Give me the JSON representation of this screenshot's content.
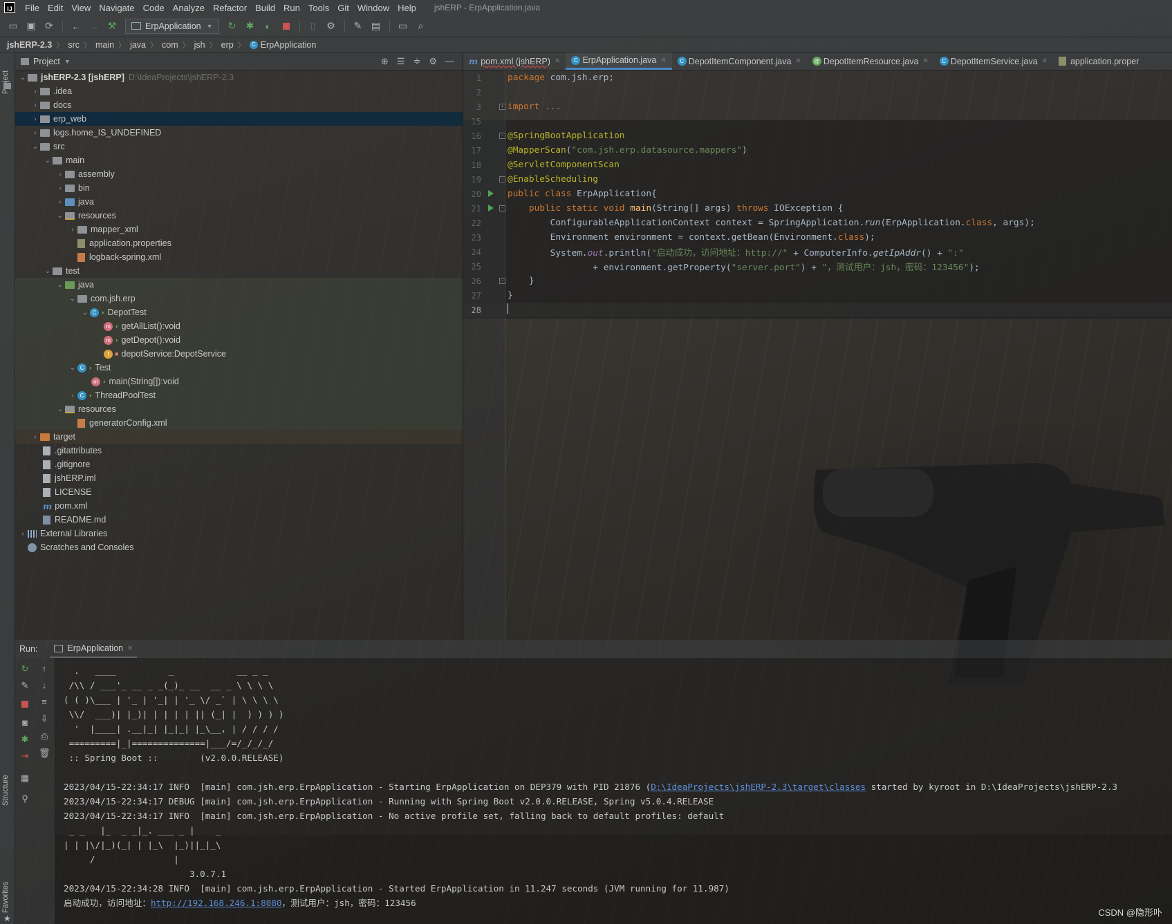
{
  "menubar": {
    "logo": "IJ",
    "items": [
      "File",
      "Edit",
      "View",
      "Navigate",
      "Code",
      "Analyze",
      "Refactor",
      "Build",
      "Run",
      "Tools",
      "Git",
      "Window",
      "Help"
    ],
    "window_title": "jshERP - ErpApplication.java"
  },
  "toolbar": {
    "run_config": "ErpApplication"
  },
  "breadcrumb": [
    "jshERP-2.3",
    "src",
    "main",
    "java",
    "com",
    "jsh",
    "erp",
    "ErpApplication"
  ],
  "side_labels": {
    "project": "Project",
    "structure": "Structure",
    "favorites": "Favorites"
  },
  "project": {
    "header": "Project",
    "tree": [
      {
        "label": "jshERP-2.3 [jshERP]",
        "hint": "D:\\IdeaProjects\\jshERP-2.3"
      },
      {
        "label": ".idea"
      },
      {
        "label": "docs"
      },
      {
        "label": "erp_web"
      },
      {
        "label": "logs.home_IS_UNDEFINED"
      },
      {
        "label": "src"
      },
      {
        "label": "main"
      },
      {
        "label": "assembly"
      },
      {
        "label": "bin"
      },
      {
        "label": "java"
      },
      {
        "label": "resources"
      },
      {
        "label": "mapper_xml"
      },
      {
        "label": "application.properties"
      },
      {
        "label": "logback-spring.xml"
      },
      {
        "label": "test"
      },
      {
        "label": "java"
      },
      {
        "label": "com.jsh.erp"
      },
      {
        "label": "DepotTest"
      },
      {
        "label": "getAllList():void"
      },
      {
        "label": "getDepot():void"
      },
      {
        "label": "depotService:DepotService"
      },
      {
        "label": "Test"
      },
      {
        "label": "main(String[]):void"
      },
      {
        "label": "ThreadPoolTest"
      },
      {
        "label": "resources"
      },
      {
        "label": "generatorConfig.xml"
      },
      {
        "label": "target"
      },
      {
        "label": ".gitattributes"
      },
      {
        "label": ".gitignore"
      },
      {
        "label": "jshERP.iml"
      },
      {
        "label": "LICENSE"
      },
      {
        "label": "pom.xml"
      },
      {
        "label": "README.md"
      },
      {
        "label": "External Libraries"
      },
      {
        "label": "Scratches and Consoles"
      }
    ]
  },
  "editor": {
    "tabs": [
      "pom.xml (jshERP)",
      "ErpApplication.java",
      "DepotItemComponent.java",
      "DepotItemResource.java",
      "DepotItemService.java",
      "application.proper"
    ],
    "line_numbers": [
      "1",
      "2",
      "3",
      "15",
      "16",
      "17",
      "18",
      "19",
      "20",
      "21",
      "22",
      "23",
      "24",
      "25",
      "26",
      "27",
      "28"
    ],
    "code": {
      "l1_kw": "package",
      "l1_rest": " com.jsh.erp;",
      "l3_kw": "import",
      "l3_rest": " ...",
      "l16": "@SpringBootApplication",
      "l17_ann": "@MapperScan",
      "l17_str": "\"com.jsh.erp.datasource.mappers\"",
      "l18": "@ServletComponentScan",
      "l19": "@EnableScheduling",
      "l20_kw": "public class",
      "l20_rest": " ErpApplication{",
      "l21_kw": "public static void",
      "l21_fn": "main",
      "l21_sig": "(String[] args) ",
      "l21_kw2": "throws",
      "l21_rest": " IOException {",
      "l22_a": "ConfigurableApplicationContext context = SpringApplication.",
      "l22_it": "run",
      "l22_b": "(ErpApplication.",
      "l22_kw": "class",
      "l22_c": ", args);",
      "l23_a": "Environment environment = context.getBean(Environment.",
      "l23_kw": "class",
      "l23_b": ");",
      "l24_a": "System.",
      "l24_fld": "out",
      "l24_b": ".println(",
      "l24_str1": "\"启动成功，访问地址：http://\"",
      "l24_c": " + ComputerInfo.",
      "l24_it": "getIpAddr",
      "l24_d": "() + ",
      "l24_str2": "\":\"",
      "l25_a": "+ environment.getProperty(",
      "l25_str1": "\"server.port\"",
      "l25_b": ") + ",
      "l25_str2": "\"，测试用户：jsh，密码：123456\"",
      "l25_c": ");",
      "l26": "}",
      "l27": "}"
    }
  },
  "run": {
    "label": "Run:",
    "tab": "ErpApplication",
    "banner": [
      "  .   ____          _            __ _ _",
      " /\\\\ / ___'_ __ _ _(_)_ __  __ _ \\ \\ \\ \\",
      "( ( )\\___ | '_ | '_| | '_ \\/ _` | \\ \\ \\ \\",
      " \\\\/  ___)| |_)| | | | | || (_| |  ) ) ) )",
      "  '  |____| .__|_| |_|_| |_\\__, | / / / /",
      " =========|_|==============|___/=/_/_/_/",
      " :: Spring Boot ::        (v2.0.0.RELEASE)"
    ],
    "log1_a": "2023/04/15-22:34:17 INFO  [main] com.jsh.erp.ErpApplication - Starting ErpApplication on DEP379 with PID 21876 (",
    "log1_link": "D:\\IdeaProjects\\jshERP-2.3\\target\\classes",
    "log1_b": " started by kyroot in D:\\IdeaProjects\\jshERP-2.3",
    "log2": "2023/04/15-22:34:17 DEBUG [main] com.jsh.erp.ErpApplication - Running with Spring Boot v2.0.0.RELEASE, Spring v5.0.4.RELEASE",
    "log3": "2023/04/15-22:34:17 INFO  [main] com.jsh.erp.ErpApplication - No active profile set, falling back to default profiles: default",
    "mp_banner": [
      " _ _   |_  _ _|_. ___ _ |    _",
      "| | |\\/|_)(_| | |_\\  |_)||_|_\\",
      "     /               |",
      "                        3.0.7.1"
    ],
    "log4": "2023/04/15-22:34:28 INFO  [main] com.jsh.erp.ErpApplication - Started ErpApplication in 11.247 seconds (JVM running for 11.987)",
    "log5_a": "启动成功，访问地址：",
    "log5_link": "http://192.168.246.1:8080",
    "log5_b": "，测试用户：jsh，密码：123456"
  },
  "watermark": "CSDN @隐形卟"
}
